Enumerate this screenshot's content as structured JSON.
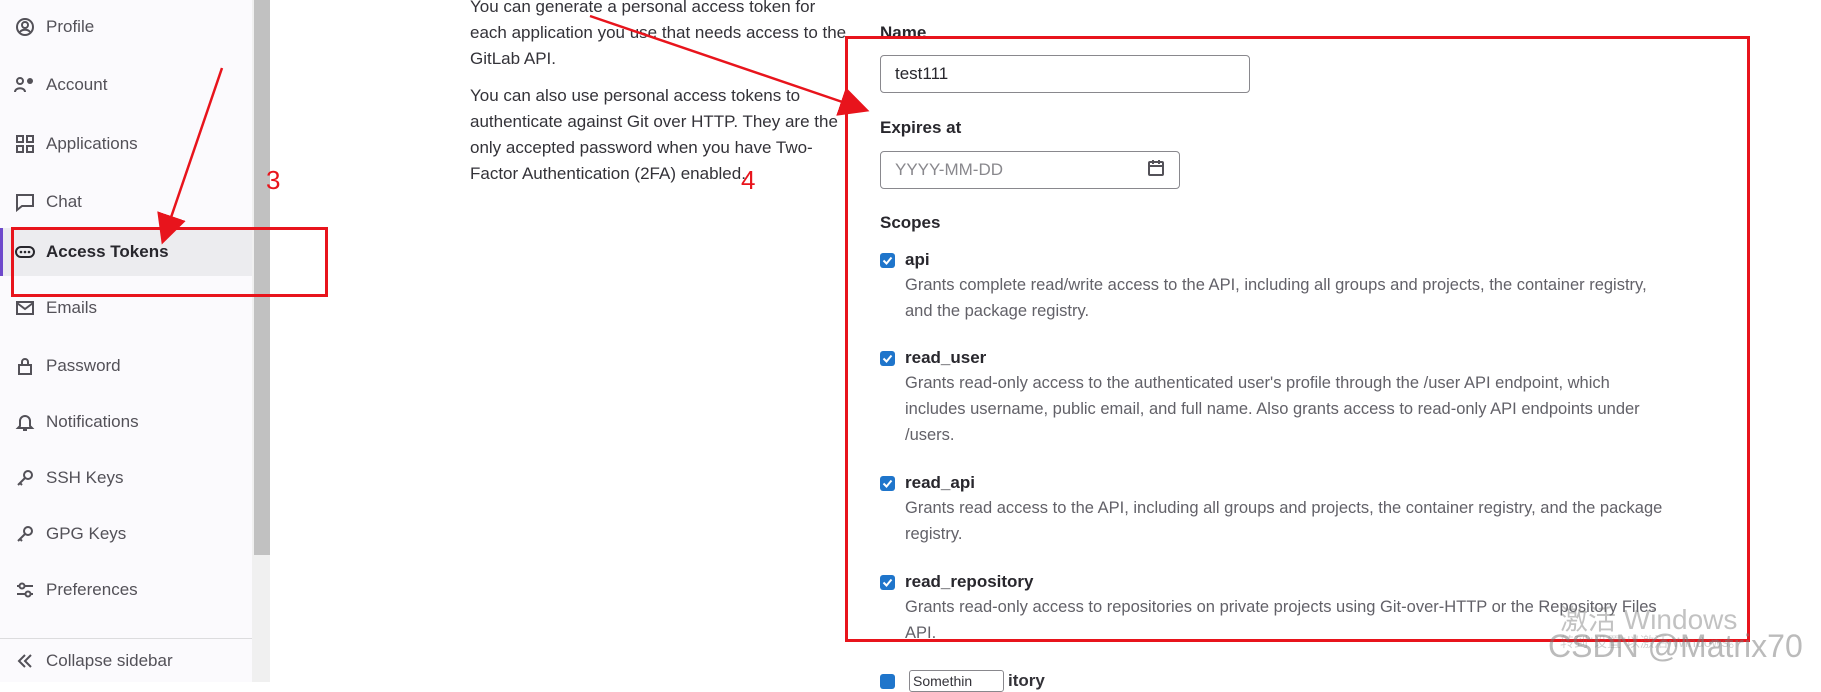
{
  "sidebar": {
    "items": [
      {
        "label": "Profile",
        "icon": "profile-icon"
      },
      {
        "label": "Account",
        "icon": "account-icon"
      },
      {
        "label": "Applications",
        "icon": "applications-icon"
      },
      {
        "label": "Chat",
        "icon": "chat-icon"
      },
      {
        "label": "Access Tokens",
        "icon": "token-icon",
        "active": true
      },
      {
        "label": "Emails",
        "icon": "email-icon"
      },
      {
        "label": "Password",
        "icon": "lock-icon"
      },
      {
        "label": "Notifications",
        "icon": "bell-icon"
      },
      {
        "label": "SSH Keys",
        "icon": "key-icon"
      },
      {
        "label": "GPG Keys",
        "icon": "key-icon"
      },
      {
        "label": "Preferences",
        "icon": "preferences-icon"
      }
    ],
    "collapse_label": "Collapse sidebar"
  },
  "description": {
    "p1_line0": "You can generate a personal access token for",
    "p1_rest": "each application you use that needs access to the GitLab API.",
    "p2": "You can also use personal access tokens to authenticate against Git over HTTP. They are the only accepted password when you have Two-Factor Authentication (2FA) enabled."
  },
  "form": {
    "name_label": "Name",
    "name_value": "test111",
    "expires_label": "Expires at",
    "expires_placeholder": "YYYY-MM-DD",
    "scopes_label": "Scopes",
    "scopes": [
      {
        "name": "api",
        "checked": true,
        "help": "Grants complete read/write access to the API, including all groups and projects, the container registry, and the package registry."
      },
      {
        "name": "read_user",
        "checked": true,
        "help": "Grants read-only access to the authenticated user's profile through the /user API endpoint, which includes username, public email, and full name. Also grants access to read-only API endpoints under /users."
      },
      {
        "name": "read_api",
        "checked": true,
        "help": "Grants read access to the API, including all groups and projects, the container registry, and the package registry."
      },
      {
        "name": "read_repository",
        "checked": true,
        "help": "Grants read-only access to repositories on private projects using Git-over-HTTP or the Repository Files API."
      }
    ],
    "partial_text_a": "Somethin",
    "partial_text_b": "itory"
  },
  "annotations": {
    "step3": "3",
    "step4": "4",
    "color": "#e8141c"
  },
  "watermark": {
    "line1": "激活 Windows",
    "line2": "CSDN @Matrix70",
    "line3": "转到\"设置\"以激活 Windows。"
  },
  "colors": {
    "accent": "#6e49cb",
    "checkbox": "#1f75cb"
  }
}
